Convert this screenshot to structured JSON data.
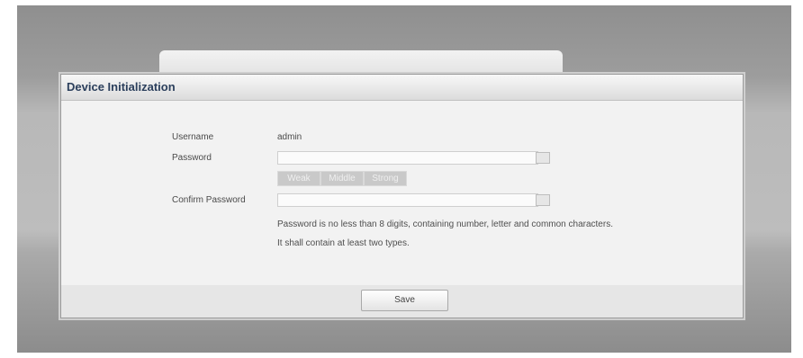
{
  "dialog": {
    "title": "Device Initialization"
  },
  "form": {
    "username_label": "Username",
    "username_value": "admin",
    "password_label": "Password",
    "password_value": "",
    "strength": [
      "Weak",
      "Middle",
      "Strong"
    ],
    "confirm_label": "Confirm Password",
    "confirm_value": "",
    "hint_line1": "Password is no less than 8 digits, containing number, letter and common characters.",
    "hint_line2": "It shall contain at least two types."
  },
  "footer": {
    "save_label": "Save"
  }
}
